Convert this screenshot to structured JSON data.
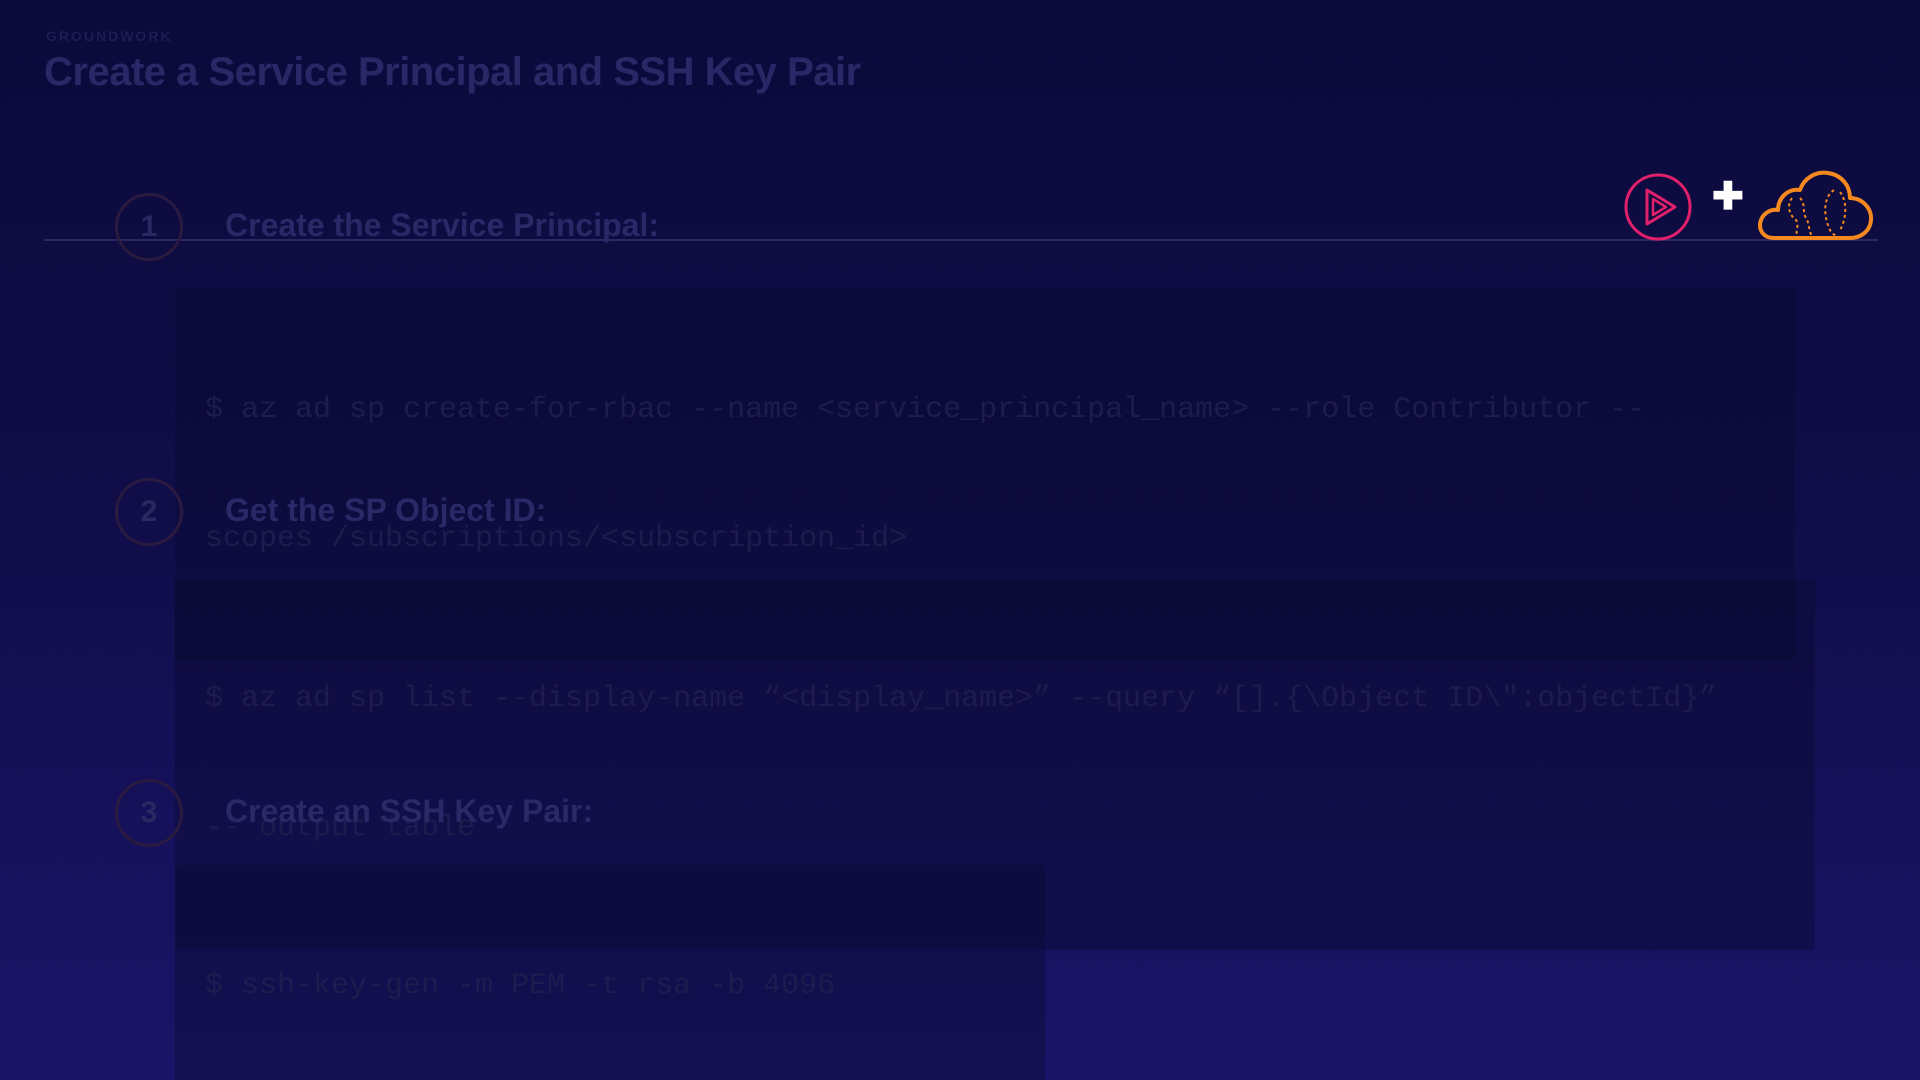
{
  "header": {
    "section_label": "GROUNDWORK",
    "title": "Create a Service Principal and SSH Key Pair"
  },
  "logos": {
    "plus": "✚",
    "play_logo_icon": "pluralsight-play-icon",
    "cloud_logo_icon": "cloud-brain-icon",
    "play_color": "#e0206a",
    "cloud_color": "#f5891f"
  },
  "steps": [
    {
      "number": "1",
      "title": "Create the Service Principal:",
      "command_lines": [
        "$ az ad sp create-for-rbac --name <service_principal_name> --role Contributor --",
        "scopes /subscriptions/<subscription_id>"
      ]
    },
    {
      "number": "2",
      "title": "Get the SP Object ID:",
      "command_lines": [
        "$ az ad sp list --display-name “<display_name>” --query “[].{\\Object ID\\\":objectId}”",
        "-- output table"
      ]
    },
    {
      "number": "3",
      "title": "Create an SSH Key Pair:",
      "command_lines": [
        "$ ssh-key-gen -m PEM -t rsa -b 4096"
      ]
    }
  ],
  "colors": {
    "background_top": "#0b0a3a",
    "background_bottom": "#1a1468",
    "accent_orange": "#f5891f",
    "accent_pink": "#e0206a"
  }
}
